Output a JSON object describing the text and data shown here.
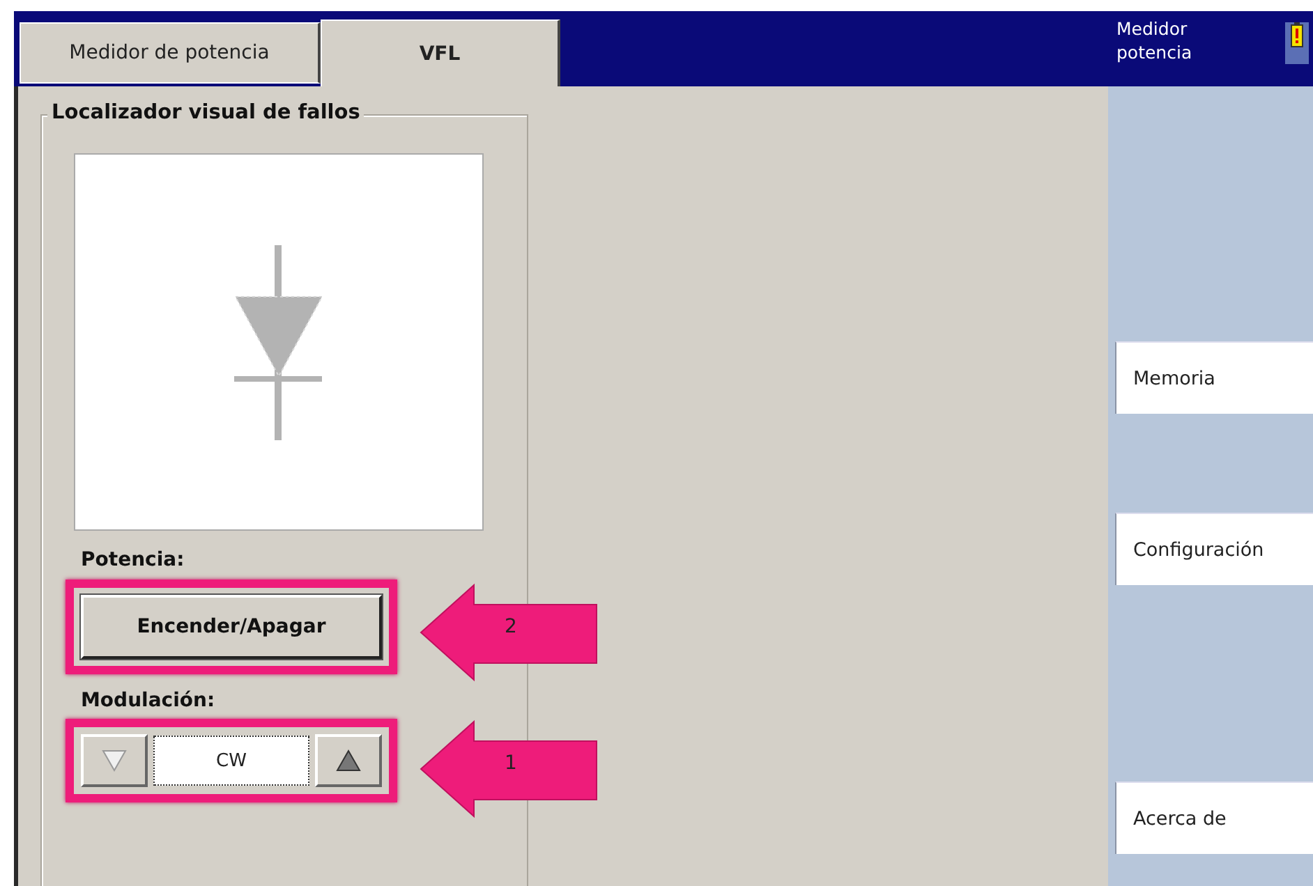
{
  "tabs": [
    {
      "label": "Medidor de potencia",
      "selected": false
    },
    {
      "label": "VFL",
      "selected": true
    }
  ],
  "group": {
    "title": "Localizador visual de fallos"
  },
  "power": {
    "label": "Potencia:",
    "button": "Encender/Apagar"
  },
  "modulation": {
    "label": "Modulación:",
    "value": "CW",
    "down_disabled": true,
    "up_disabled": false
  },
  "side_panel": {
    "title": "Medidor potencia",
    "warning": true,
    "buttons": [
      "Memoria",
      "Configuración",
      "Acerca de"
    ]
  },
  "annotations": [
    {
      "number": "2"
    },
    {
      "number": "1"
    }
  ]
}
